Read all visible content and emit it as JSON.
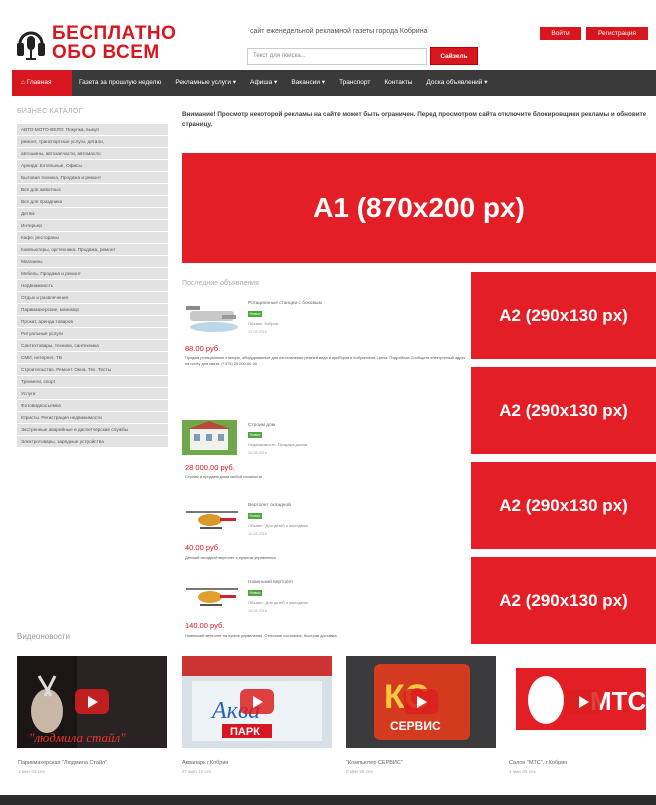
{
  "header": {
    "logo_line1": "БЕСПЛАТНО",
    "logo_line2": "ОБО ВСЕМ",
    "tagline": "сайт еженедельной рекламной газеты города Кобрина",
    "search_placeholder": "Текст для поиска...",
    "search_button": "Сайзель",
    "login": "Войти",
    "register": "Регистрация"
  },
  "nav": {
    "items": [
      "Главная",
      "Газета за прошлую неделю",
      "Рекламные услуги ▾",
      "Афиша ▾",
      "Вакансии ▾",
      "Транспорт",
      "Контакты",
      "Доска объявлений ▾"
    ]
  },
  "sidebar": {
    "title": "БИЗНЕС КАТАЛОГ",
    "items": [
      "АВТО-МОТО-ВЕЛО: Покупка, выкуп",
      "ремонт, транспортные услуги, детали,",
      "автошины, автозапчасти, автомасло",
      "Аренда: Котельные, Офисы",
      "Бытовая техника, Продажа и ремонт",
      "Все для животных",
      "Все для праздника",
      "Детям",
      "Интерьер",
      "Кафе, рестораны",
      "Компьютеры, оргтехника. Продажа, ремонт",
      "Магазины",
      "Мебель. Продажа и ремонт",
      "Недвижимость",
      "Отдых и развлечения",
      "Парикмахерские, маникюр",
      "Прокат, аренда товаров",
      "Ритуальные услуги",
      "Сантехтовары, техника, сантехника",
      "СМИ, интернет, ТВ",
      "Строительство. Ремонт. Окна. Тех. Тесты",
      "Тренинги, спорт",
      "Услуги",
      "Фотовидеосъемка",
      "Юристы. Регистрация недвижимости",
      "Экстренные аварийные и диспетчерские службы",
      "Электротовары, зарядные устройства"
    ]
  },
  "notice": "Внимание! Просмотр некоторой рекламы на сайте может быть ограничен. Перед просмотром сайта отключите блокировщики рекламы и обновите страницу.",
  "ads": {
    "a1": "A1 (870x200 px)",
    "a2": [
      "A2 (290x130 px)",
      "A2 (290x130 px)",
      "A2 (290x130 px)",
      "A2 (290x130 px)"
    ]
  },
  "listings": {
    "title": "Последние объявления",
    "items": [
      {
        "title": "Ротационные станции с боковым",
        "badge": "Новое",
        "meta": "Объявл. Кобрин",
        "date": "10.08.2016",
        "price": "88.00 руб.",
        "desc": "Продам ротационные станции, оборудованные для изготовления ремней вида и приборов в Кобринском. Цены: Подробная Сообщите электронный адрес на почту для связи. (+375) 29 000-00-00"
      },
      {
        "title": "Строим дом",
        "badge": "Новое",
        "meta": "Недвижимость: Продажа домов",
        "date": "10.08.2016",
        "price": "28 000.00 руб.",
        "desc": "Строим и продаем дома любой сложности"
      },
      {
        "title": "Вертолет складной",
        "badge": "Новое",
        "meta": "Объявл.: Для детей и молодежи",
        "date": "10.08.2016",
        "price": "40.00 руб.",
        "desc": "Детский складной вертолет с пультом управления"
      },
      {
        "title": "Новенький вертолет",
        "badge": "Новое",
        "meta": "Объявл.: Для детей и молодежи",
        "date": "10.08.2016",
        "price": "140.00 руб.",
        "desc": "Новенький вертолет на пульте управления. Отличное состояние, быстрая доставка."
      }
    ]
  },
  "videos": {
    "title": "Видеоновости",
    "items": [
      {
        "caption": "Парикмахерская \"Людмила Стайл\"",
        "duration": "1 мин 03 сек"
      },
      {
        "caption": "Аквапарк г.Кобрин",
        "duration": "27 мин 12 сек"
      },
      {
        "caption": "\"Компьютер СЕРВИС\"",
        "duration": "0 мин 58 сек"
      },
      {
        "caption": "Салон \"МТС\", г.Кобрин",
        "duration": "1 мин 00 сек"
      }
    ]
  },
  "colors": {
    "brand": "#d7161f",
    "ad": "#e41e26",
    "nav": "#3a3a3a"
  }
}
